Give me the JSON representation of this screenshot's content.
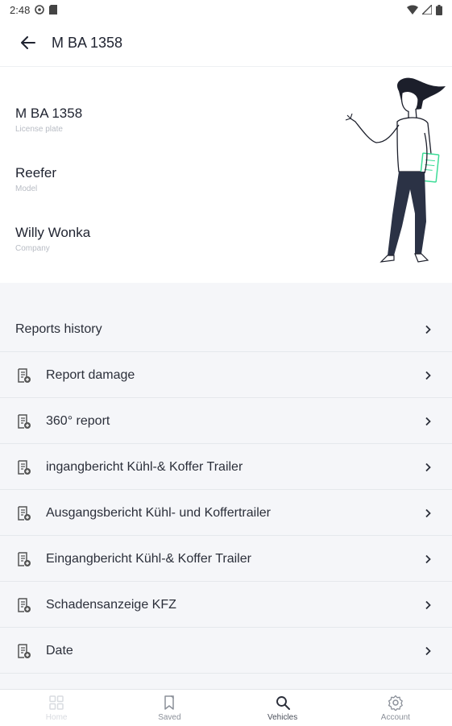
{
  "status_bar": {
    "time": "2:48"
  },
  "app_bar": {
    "title": "M BA 1358"
  },
  "vehicle": {
    "license_plate_value": "M BA 1358",
    "license_plate_label": "License plate",
    "model_value": "Reefer",
    "model_label": "Model",
    "company_value": "Willy Wonka",
    "company_label": "Company"
  },
  "reports_history": {
    "label": "Reports history"
  },
  "report_items": [
    {
      "label": "Report damage"
    },
    {
      "label": "360° report"
    },
    {
      "label": "ingangbericht Kühl-& Koffer Trailer"
    },
    {
      "label": "Ausgangsbericht Kühl- und Koffertrailer"
    },
    {
      "label": "Eingangbericht Kühl-& Koffer Trailer"
    },
    {
      "label": "Schadensanzeige KFZ"
    },
    {
      "label": "Date"
    }
  ],
  "bottom_nav": [
    {
      "label": "Home",
      "icon": "home-grid-icon"
    },
    {
      "label": "Saved",
      "icon": "bookmark-icon"
    },
    {
      "label": "Vehicles",
      "icon": "search-icon"
    },
    {
      "label": "Account",
      "icon": "gear-icon"
    }
  ],
  "colors": {
    "list_background": "#f5f6f9",
    "text": "#1f2330",
    "muted": "#b8bcc4",
    "accent_green": "#3ddc97"
  }
}
